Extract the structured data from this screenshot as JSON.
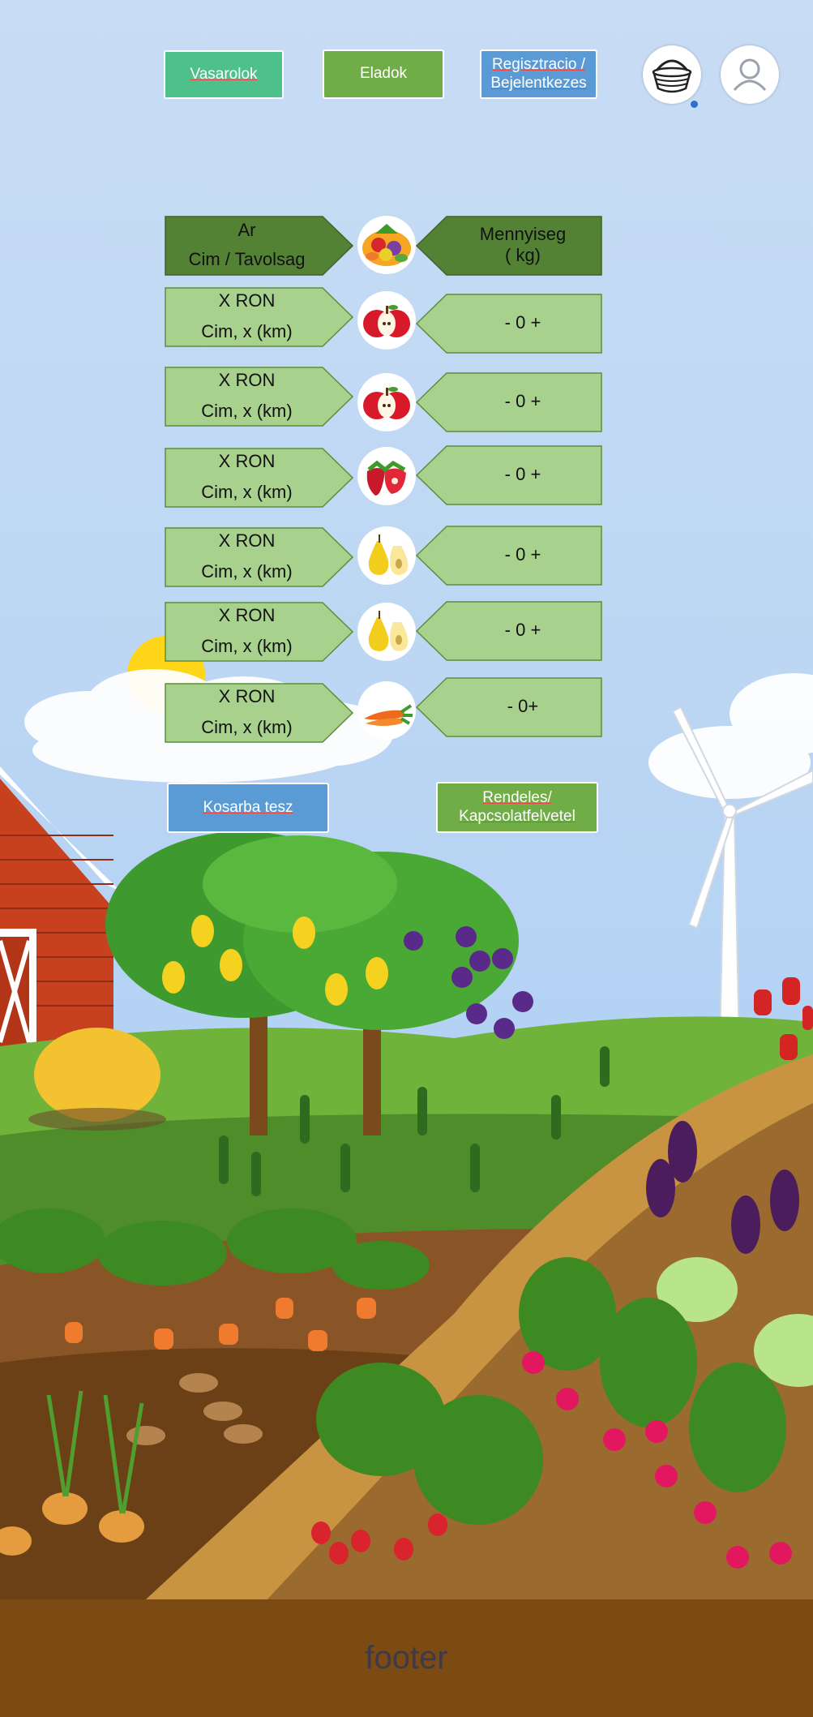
{
  "nav": {
    "buyers": "Vasarolok",
    "sellers": "Eladok",
    "register_line1": "Regisztracio /",
    "register_line2": "Bejelentkezes"
  },
  "table": {
    "header": {
      "price": "Ar",
      "address": "Cim / Tavolsag",
      "quantity_line1": "Mennyiseg",
      "quantity_line2": "( kg)"
    },
    "rows": [
      {
        "price": "X RON",
        "address": "Cim, x (km)",
        "quantity": "- 0 +",
        "produce_icon": "apple-icon"
      },
      {
        "price": "X RON",
        "address": "Cim, x (km)",
        "quantity": "- 0 +",
        "produce_icon": "apple-icon"
      },
      {
        "price": "X RON",
        "address": "Cim, x (km)",
        "quantity": "- 0 +",
        "produce_icon": "strawberry-icon"
      },
      {
        "price": "X RON",
        "address": "Cim, x (km)",
        "quantity": "- 0 +",
        "produce_icon": "pear-icon"
      },
      {
        "price": "X RON",
        "address": "Cim, x (km)",
        "quantity": "- 0 +",
        "produce_icon": "pear-icon"
      },
      {
        "price": "X RON",
        "address": "Cim, x (km)",
        "quantity": "- 0+",
        "produce_icon": "carrot-icon"
      }
    ]
  },
  "actions": {
    "add_to_cart": "Kosarba tesz",
    "order_line1": "Rendeles/",
    "order_line2": "Kapcsolatfelvetel"
  },
  "footer": {
    "label": "footer"
  },
  "colors": {
    "buyers_button": "#4dc08c",
    "green_button": "#70ad47",
    "blue_button": "#5b9bd5",
    "header_cell": "#548235",
    "row_cell": "#a9d18e",
    "footer_bg": "#7c4a13"
  }
}
